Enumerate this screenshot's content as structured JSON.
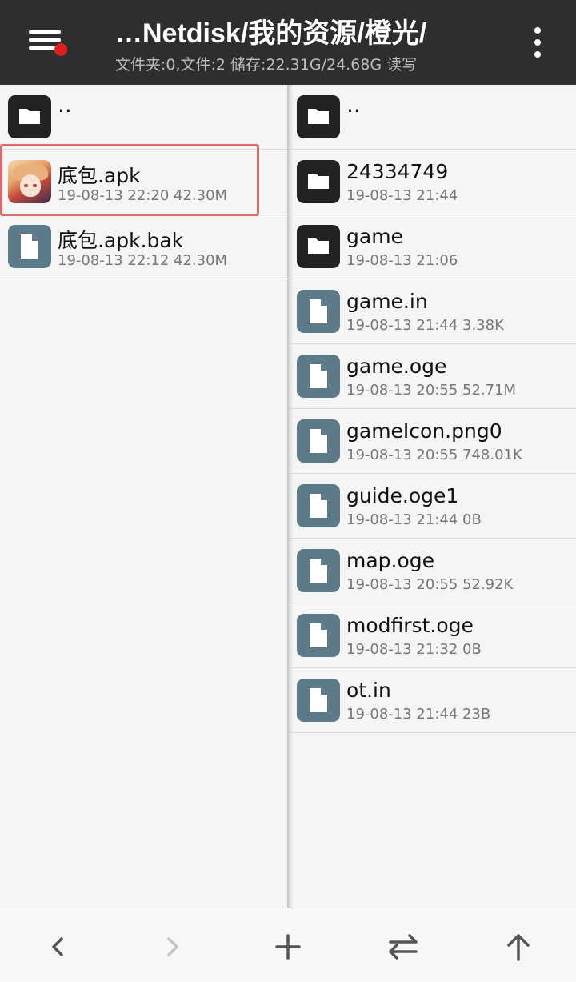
{
  "header": {
    "path": "…Netdisk/我的资源/橙光/",
    "stats": "文件夹:0,文件:2  储存:22.31G/24.68G  读写"
  },
  "left_pane": {
    "items": [
      {
        "name": "..",
        "meta": "",
        "icon": "folder-icon"
      },
      {
        "name": "底包.apk",
        "meta": "19-08-13 22:20   42.30M",
        "icon": "apk-app-icon",
        "highlighted": true
      },
      {
        "name": "底包.apk.bak",
        "meta": "19-08-13 22:12   42.30M",
        "icon": "file-icon"
      }
    ]
  },
  "right_pane": {
    "items": [
      {
        "name": "..",
        "meta": "",
        "icon": "folder-icon"
      },
      {
        "name": "24334749",
        "meta": "19-08-13 21:44",
        "icon": "folder-icon"
      },
      {
        "name": "game",
        "meta": "19-08-13 21:06",
        "icon": "folder-icon"
      },
      {
        "name": "game.in",
        "meta": "19-08-13 21:44   3.38K",
        "icon": "file-icon"
      },
      {
        "name": "game.oge",
        "meta": "19-08-13 20:55   52.71M",
        "icon": "file-icon"
      },
      {
        "name": "gameIcon.png0",
        "meta": "19-08-13 20:55   748.01K",
        "icon": "file-icon"
      },
      {
        "name": "guide.oge1",
        "meta": "19-08-13 21:44   0B",
        "icon": "file-icon"
      },
      {
        "name": "map.oge",
        "meta": "19-08-13 20:55   52.92K",
        "icon": "file-icon"
      },
      {
        "name": "modfirst.oge",
        "meta": "19-08-13 21:32   0B",
        "icon": "file-icon"
      },
      {
        "name": "ot.in",
        "meta": "19-08-13 21:44   23B",
        "icon": "file-icon"
      }
    ]
  },
  "bottom_bar": {
    "buttons": [
      "back-icon",
      "forward-icon",
      "plus-icon",
      "swap-icon",
      "up-arrow-icon"
    ]
  },
  "colors": {
    "header_bg": "#2e2e2e",
    "folder_icon": "#222222",
    "file_icon": "#5c7a87",
    "highlight": "#e0676b",
    "notification_dot": "#e02020"
  }
}
